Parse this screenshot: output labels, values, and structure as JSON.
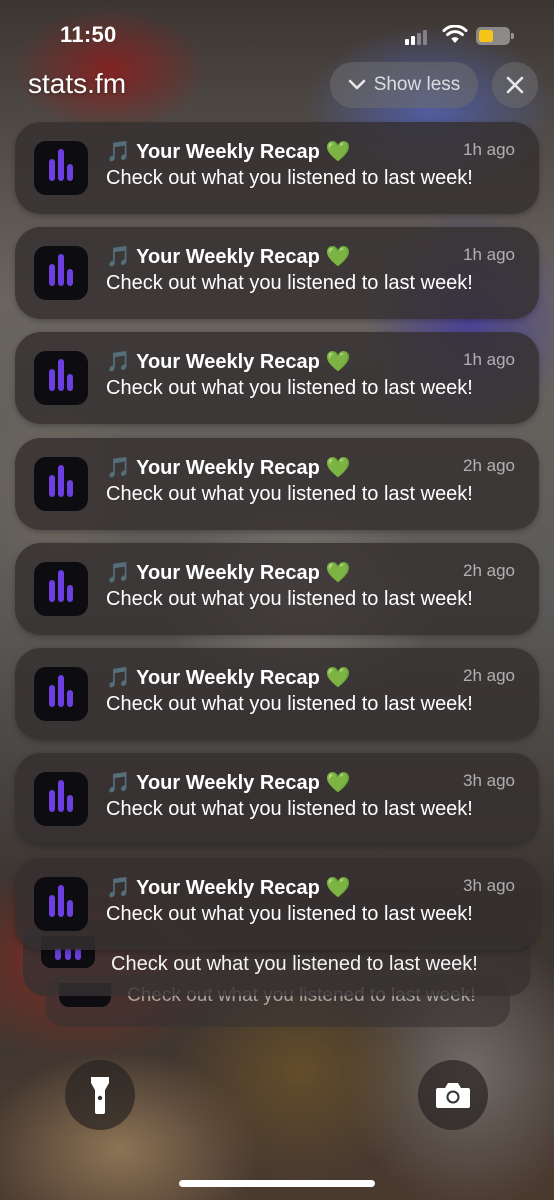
{
  "status_bar": {
    "time": "11:50",
    "signal_bars_filled": 2,
    "signal_bars_total": 4,
    "battery_level": 0.5,
    "battery_color": "#f5c518"
  },
  "group": {
    "app_name": "stats.fm",
    "show_less_label": "Show less",
    "show_less_icon": "chevron-down-icon",
    "close_icon": "close-icon"
  },
  "app_icon": {
    "name": "stats-fm-icon",
    "bar_color": "#6b3fe0",
    "background": "#0d0d11"
  },
  "notifications": [
    {
      "emoji_prefix": "🎵",
      "title": "Your Weekly Recap",
      "emoji_suffix": "💚",
      "time": "1h ago",
      "body": "Check out what you listened to last week!"
    },
    {
      "emoji_prefix": "🎵",
      "title": "Your Weekly Recap",
      "emoji_suffix": "💚",
      "time": "1h ago",
      "body": "Check out what you listened to last week!"
    },
    {
      "emoji_prefix": "🎵",
      "title": "Your Weekly Recap",
      "emoji_suffix": "💚",
      "time": "1h ago",
      "body": "Check out what you listened to last week!"
    },
    {
      "emoji_prefix": "🎵",
      "title": "Your Weekly Recap",
      "emoji_suffix": "💚",
      "time": "2h ago",
      "body": "Check out what you listened to last week!"
    },
    {
      "emoji_prefix": "🎵",
      "title": "Your Weekly Recap",
      "emoji_suffix": "💚",
      "time": "2h ago",
      "body": "Check out what you listened to last week!"
    },
    {
      "emoji_prefix": "🎵",
      "title": "Your Weekly Recap",
      "emoji_suffix": "💚",
      "time": "2h ago",
      "body": "Check out what you listened to last week!"
    },
    {
      "emoji_prefix": "🎵",
      "title": "Your Weekly Recap",
      "emoji_suffix": "💚",
      "time": "3h ago",
      "body": "Check out what you listened to last week!"
    },
    {
      "emoji_prefix": "🎵",
      "title": "Your Weekly Recap",
      "emoji_suffix": "💚",
      "time": "3h ago",
      "body": "Check out what you listened to last week!"
    }
  ],
  "stacked": [
    {
      "body": "Check out what you listened to last week!"
    },
    {
      "body": "Check out what you listened to last week!"
    }
  ],
  "quick_actions": {
    "left": "flashlight-icon",
    "right": "camera-icon"
  }
}
